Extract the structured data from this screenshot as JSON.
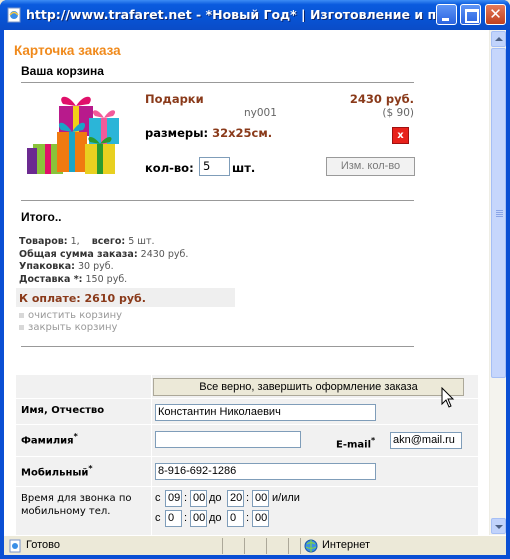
{
  "window": {
    "title": "http://www.trafaret.net - *Новый Год* | Изготовление и прод..."
  },
  "page": {
    "title": "Карточка заказа",
    "cart_title": "Ваша корзина"
  },
  "product": {
    "name": "Подарки",
    "price": "2430 руб.",
    "code": "ny001",
    "price_usd": "($ 90)",
    "size_label": "размеры:",
    "size_value": "32x25см.",
    "delete_label": "x",
    "qty_label": "кол-во:",
    "qty_value": "5",
    "qty_unit": "шт.",
    "change_qty_button": "Изм. кол-во"
  },
  "summary": {
    "title": "Итого..",
    "items_label": "Товаров:",
    "items_value": "1,",
    "total_qty_label": "всего:",
    "total_qty_value": "5 шт.",
    "order_sum_label": "Общая сумма заказа:",
    "order_sum_value": "2430 руб.",
    "packing_label": "Упаковка:",
    "packing_value": "30 руб.",
    "delivery_label": "Доставка *:",
    "delivery_value": "150 руб.",
    "pay_label": "К оплате: 2610 руб.",
    "clear_cart": "очистить корзину",
    "close_cart": "закрыть корзину"
  },
  "form": {
    "submit_button": "Все верно, завершить оформление заказа",
    "name_label": "Имя, Отчество",
    "name_value": "Константин Николаевич",
    "surname_label": "Фамилия",
    "surname_value": "",
    "email_label": "E-mail",
    "email_value": "akn@mail.ru",
    "mobile_label": "Мобильный",
    "mobile_value": "8-916-692-1286",
    "required_mark": "*",
    "call_time_label": "Время для звонка по мобильному тел.",
    "from_label": "с",
    "to_label": "до",
    "colon": ":",
    "time_from_h": "09",
    "time_from_m": "00",
    "time_to_h": "20",
    "time_to_m": "00",
    "or_label": "и/или",
    "time2_from_h": "0",
    "time2_from_m": "00",
    "time2_to_h": "0",
    "time2_to_m": "00"
  },
  "statusbar": {
    "status": "Готово",
    "zone": "Интернет"
  },
  "colors": {
    "accent": "#f08a1c",
    "price": "#8a3a1a",
    "titlebar": "#0a5bde"
  }
}
